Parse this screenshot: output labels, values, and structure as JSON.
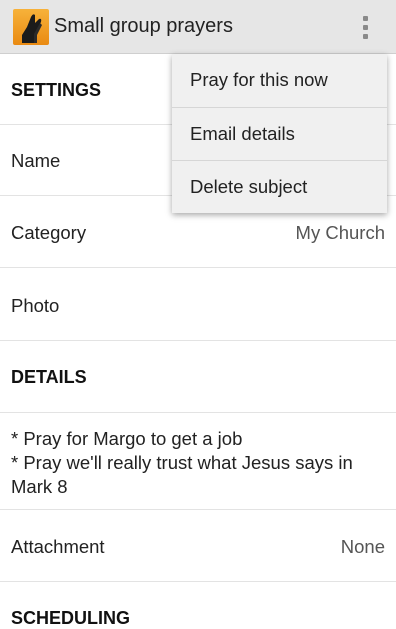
{
  "appbar": {
    "title": "Small group prayers",
    "icon": "praying-hands-icon",
    "overflow_icon": "overflow-menu-icon",
    "accent": "#f0a228"
  },
  "sections": {
    "settings": "SETTINGS",
    "details": "DETAILS",
    "scheduling": "SCHEDULING"
  },
  "fields": {
    "name_label": "Name",
    "category_label": "Category",
    "category_value": "My Church",
    "photo_label": "Photo",
    "attachment_label": "Attachment",
    "attachment_value": "None"
  },
  "details": {
    "line1": "* Pray for Margo to get a job",
    "line2": "* Pray we'll really trust what Jesus says in Mark 8"
  },
  "menu": {
    "items": [
      "Pray for this now",
      "Email details",
      "Delete subject"
    ]
  }
}
